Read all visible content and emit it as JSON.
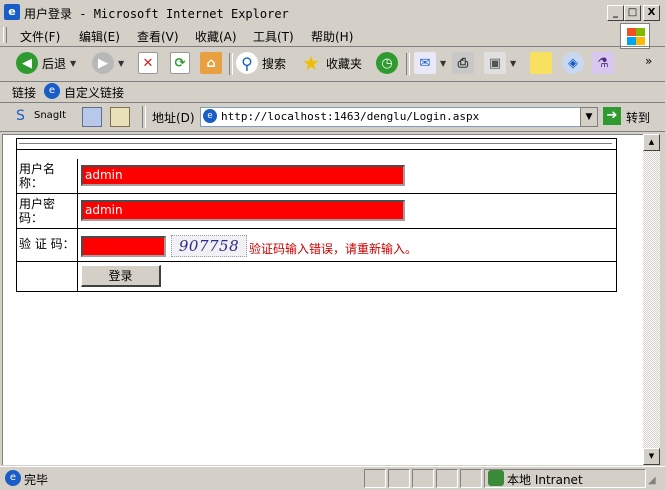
{
  "window": {
    "title_cn": "用户登录",
    "title_sep": " - ",
    "title_app": "Microsoft Internet Explorer",
    "min": "_",
    "max": "□",
    "close": "X"
  },
  "menu": {
    "items": [
      "文件(F)",
      "编辑(E)",
      "查看(V)",
      "收藏(A)",
      "工具(T)",
      "帮助(H)"
    ]
  },
  "toolbar": {
    "back": "后退",
    "search": "搜索",
    "favorites": "收藏夹"
  },
  "links": {
    "label": "链接",
    "custom": "自定义链接"
  },
  "addressbar": {
    "snagit": "SnagIt",
    "label": "地址(D)",
    "url": "http://localhost:1463/denglu/Login.aspx",
    "go": "转到"
  },
  "form": {
    "username_label": "用户名称：",
    "username_value": "admin",
    "password_label": "用户密码：",
    "password_value": "admin",
    "captcha_label": "验 证 码：",
    "captcha_value": "",
    "captcha_image_text": "907758",
    "error_message": "验证码输入错误，请重新输入。",
    "login_button": "登录"
  },
  "status": {
    "text": "完毕",
    "zone": "本地 Intranet"
  },
  "colors": {
    "input_bg": "#ff0000",
    "error": "#cc0000"
  }
}
